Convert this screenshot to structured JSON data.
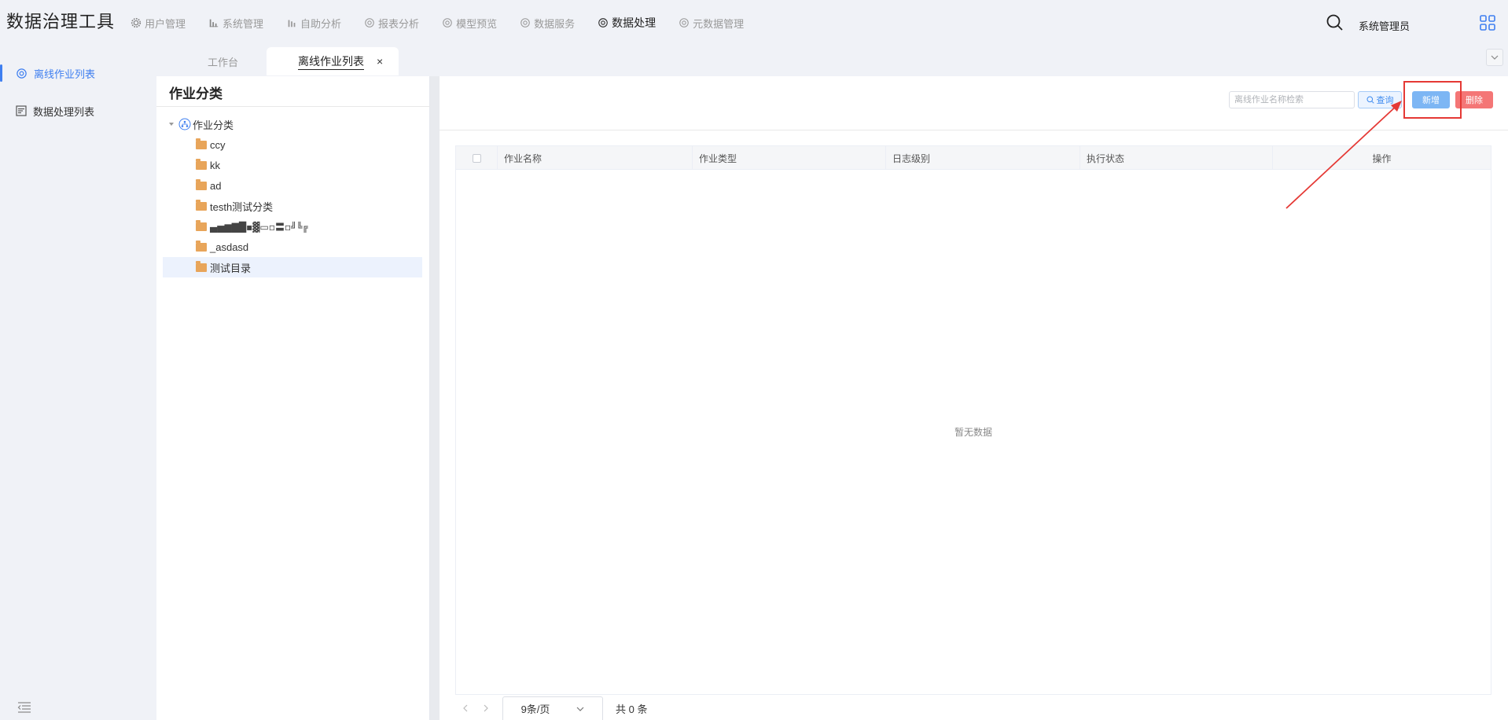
{
  "app": {
    "title": "数据治理工具"
  },
  "nav": {
    "items": [
      {
        "label": "用户管理",
        "icon": "gear-icon"
      },
      {
        "label": "系统管理",
        "icon": "bar-chart-icon"
      },
      {
        "label": "自助分析",
        "icon": "bar-chart-icon"
      },
      {
        "label": "报表分析",
        "icon": "gear-icon"
      },
      {
        "label": "模型预览",
        "icon": "gear-icon"
      },
      {
        "label": "数据服务",
        "icon": "gear-icon"
      },
      {
        "label": "数据处理",
        "icon": "gear-icon",
        "active": true
      },
      {
        "label": "元数据管理",
        "icon": "gear-icon"
      }
    ]
  },
  "user": {
    "name": "系统管理员"
  },
  "sidebar": {
    "items": [
      {
        "label": "离线作业列表",
        "icon": "gear-icon",
        "active": true
      },
      {
        "label": "数据处理列表",
        "icon": "list-icon"
      }
    ]
  },
  "tabs": [
    {
      "label": "工作台"
    },
    {
      "label": "离线作业列表",
      "active": true,
      "close": "×"
    }
  ],
  "tree": {
    "title": "作业分类",
    "root": "作业分类",
    "folders": [
      "ccy",
      "kk",
      "ad",
      "testh测试分类",
      "▄▅▆▇█▪▓▭▫〓▫╝╚╔",
      "_asdasd",
      "测试目录"
    ],
    "selected_index": 6
  },
  "toolbar": {
    "search_placeholder": "离线作业名称检索",
    "query_label": "查询",
    "add_label": "新增",
    "delete_label": "删除"
  },
  "table": {
    "columns": [
      "作业名称",
      "作业类型",
      "日志级别",
      "执行状态",
      "操作"
    ],
    "empty_text": "暂无数据"
  },
  "pager": {
    "page_size": "9条/页",
    "total": "共 0 条"
  },
  "colors": {
    "accent": "#3f7ff0",
    "add_button": "#7db6f4",
    "delete_button": "#f47676",
    "annotation": "#e53935"
  }
}
